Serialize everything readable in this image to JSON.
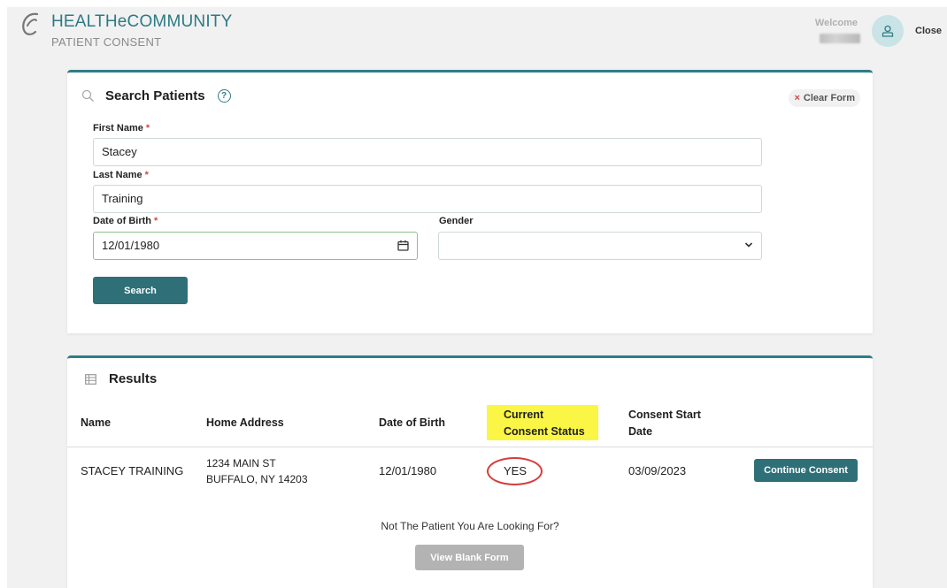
{
  "header": {
    "brand_title": "HEALTHeCOMMUNITY",
    "brand_subtitle": "PATIENT CONSENT",
    "welcome_label": "Welcome",
    "close_label": "Close"
  },
  "search": {
    "title": "Search Patients",
    "clear_form_label": "Clear Form",
    "first_name": {
      "label": "First Name",
      "value": "Stacey",
      "required": "*"
    },
    "last_name": {
      "label": "Last Name",
      "value": "Training",
      "required": "*"
    },
    "dob": {
      "label": "Date of Birth",
      "value": "12/01/1980",
      "required": "*"
    },
    "gender": {
      "label": "Gender",
      "value": ""
    },
    "search_button": "Search"
  },
  "results": {
    "title": "Results",
    "columns": {
      "name": "Name",
      "address": "Home Address",
      "dob": "Date of Birth",
      "status_line1": "Current",
      "status_line2": "Consent Status",
      "start_line1": "Consent Start",
      "start_line2": "Date"
    },
    "rows": [
      {
        "name": "STACEY TRAINING",
        "address_line1": "1234 MAIN ST",
        "address_line2": "BUFFALO, NY 14203",
        "dob": "12/01/1980",
        "status": "YES",
        "start_date": "03/09/2023",
        "action": "Continue Consent"
      }
    ],
    "not_patient_text": "Not The Patient You Are Looking For?",
    "blank_form_button": "View Blank Form"
  },
  "colors": {
    "brand_teal": "#2e7d87",
    "button_teal": "#2e6f78",
    "highlight_yellow": "#fbf646",
    "annotation_red": "#d63b3b"
  },
  "icons": [
    "logo-icon",
    "user-icon",
    "search-icon",
    "help-icon",
    "close-x-icon",
    "calendar-icon",
    "chevron-down-icon",
    "table-icon"
  ]
}
